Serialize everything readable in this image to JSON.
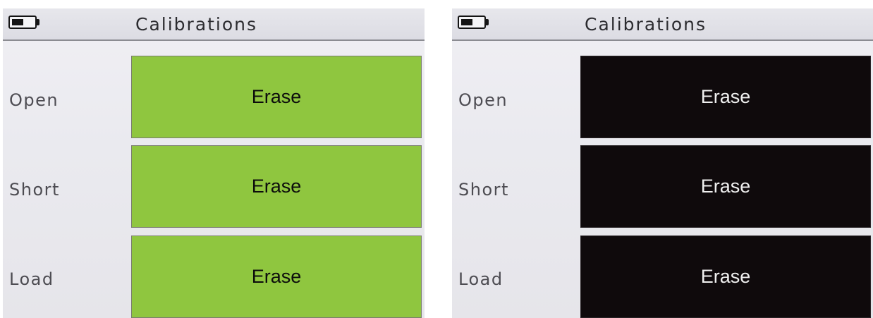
{
  "screens": [
    {
      "variant": "green",
      "status_bar": {
        "battery_icon": "battery-icon",
        "title": "Calibrations"
      },
      "rows": [
        {
          "label": "Open",
          "button_label": "Erase"
        },
        {
          "label": "Short",
          "button_label": "Erase"
        },
        {
          "label": "Load",
          "button_label": "Erase"
        }
      ],
      "colors": {
        "button_bg": "#8fc63f",
        "button_text": "#0c0c0c"
      }
    },
    {
      "variant": "black",
      "status_bar": {
        "battery_icon": "battery-icon",
        "title": "Calibrations"
      },
      "rows": [
        {
          "label": "Open",
          "button_label": "Erase"
        },
        {
          "label": "Short",
          "button_label": "Erase"
        },
        {
          "label": "Load",
          "button_label": "Erase"
        }
      ],
      "colors": {
        "button_bg": "#0f0a0c",
        "button_text": "#f0f0f0"
      }
    }
  ]
}
